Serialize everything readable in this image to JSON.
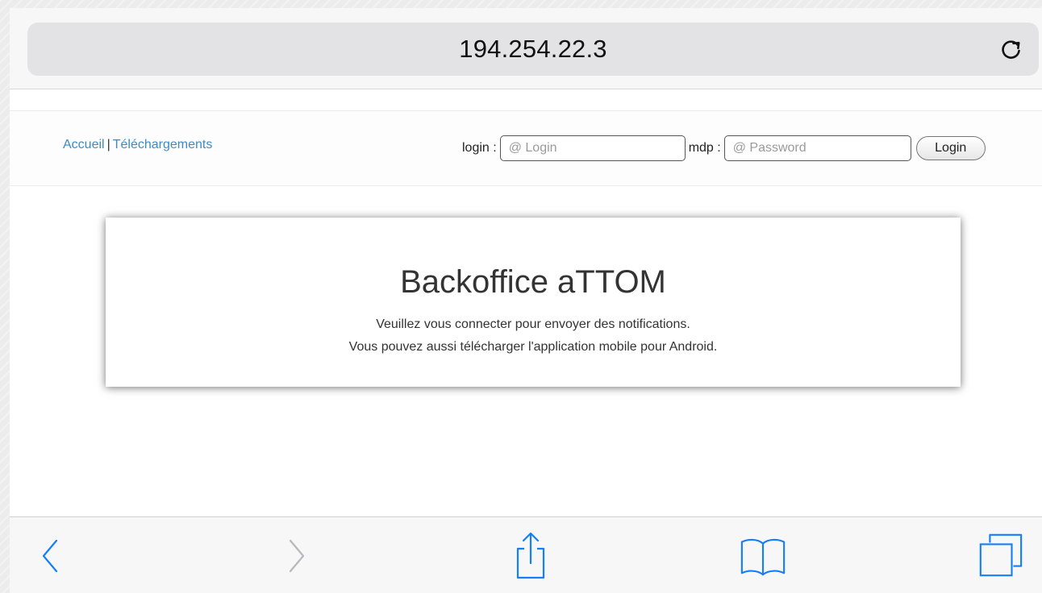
{
  "browser": {
    "address": "194.254.22.3",
    "icons": {
      "reload": "reload-icon",
      "back": "chevron-left-icon",
      "forward": "chevron-right-icon",
      "share": "share-icon",
      "bookmarks": "book-icon",
      "tabs": "tabs-icon"
    },
    "accent_color": "#147efb"
  },
  "nav": {
    "home_label": "Accueil",
    "separator": "|",
    "downloads_label": "Téléchargements",
    "link_color": "#3a8bc7"
  },
  "login": {
    "login_label": "login :",
    "login_placeholder": "@ Login",
    "login_value": "",
    "password_label": "mdp :",
    "password_placeholder": "@ Password",
    "password_value": "",
    "submit_label": "Login"
  },
  "hero": {
    "title": "Backoffice aTTOM",
    "line1": "Veuillez vous connecter pour envoyer des notifications.",
    "line2": "Vous pouvez aussi télécharger l'application mobile pour Android."
  }
}
